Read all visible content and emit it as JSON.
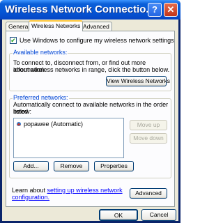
{
  "window": {
    "title": "Wireless Network Connectio...",
    "help_label": "?",
    "close_label": "✕"
  },
  "tabs": [
    "General",
    "Wireless Networks",
    "Advanced"
  ],
  "use_windows": {
    "label": "Use Windows to configure my wireless network settings",
    "checked": true,
    "check_mark": "✔"
  },
  "available": {
    "title": "Available networks:",
    "text_line1": "To connect to, disconnect from, or find out more information",
    "text_line2": "about wireless networks in range, click the button below.",
    "view_button": "View Wireless Networks"
  },
  "preferred": {
    "title": "Preferred networks:",
    "text_line1": "Automatically connect to available networks in the order listed",
    "text_line2": "below:",
    "items": [
      "popawee (Automatic)"
    ],
    "move_up": "Move up",
    "move_down": "Move down",
    "add": "Add...",
    "remove": "Remove",
    "properties": "Properties"
  },
  "learn": {
    "prefix": "Learn about ",
    "link_part1": "setting up wireless network",
    "link_part2": "configuration.",
    "advanced_button": "Advanced"
  },
  "dialog": {
    "ok": "OK",
    "cancel": "Cancel"
  }
}
